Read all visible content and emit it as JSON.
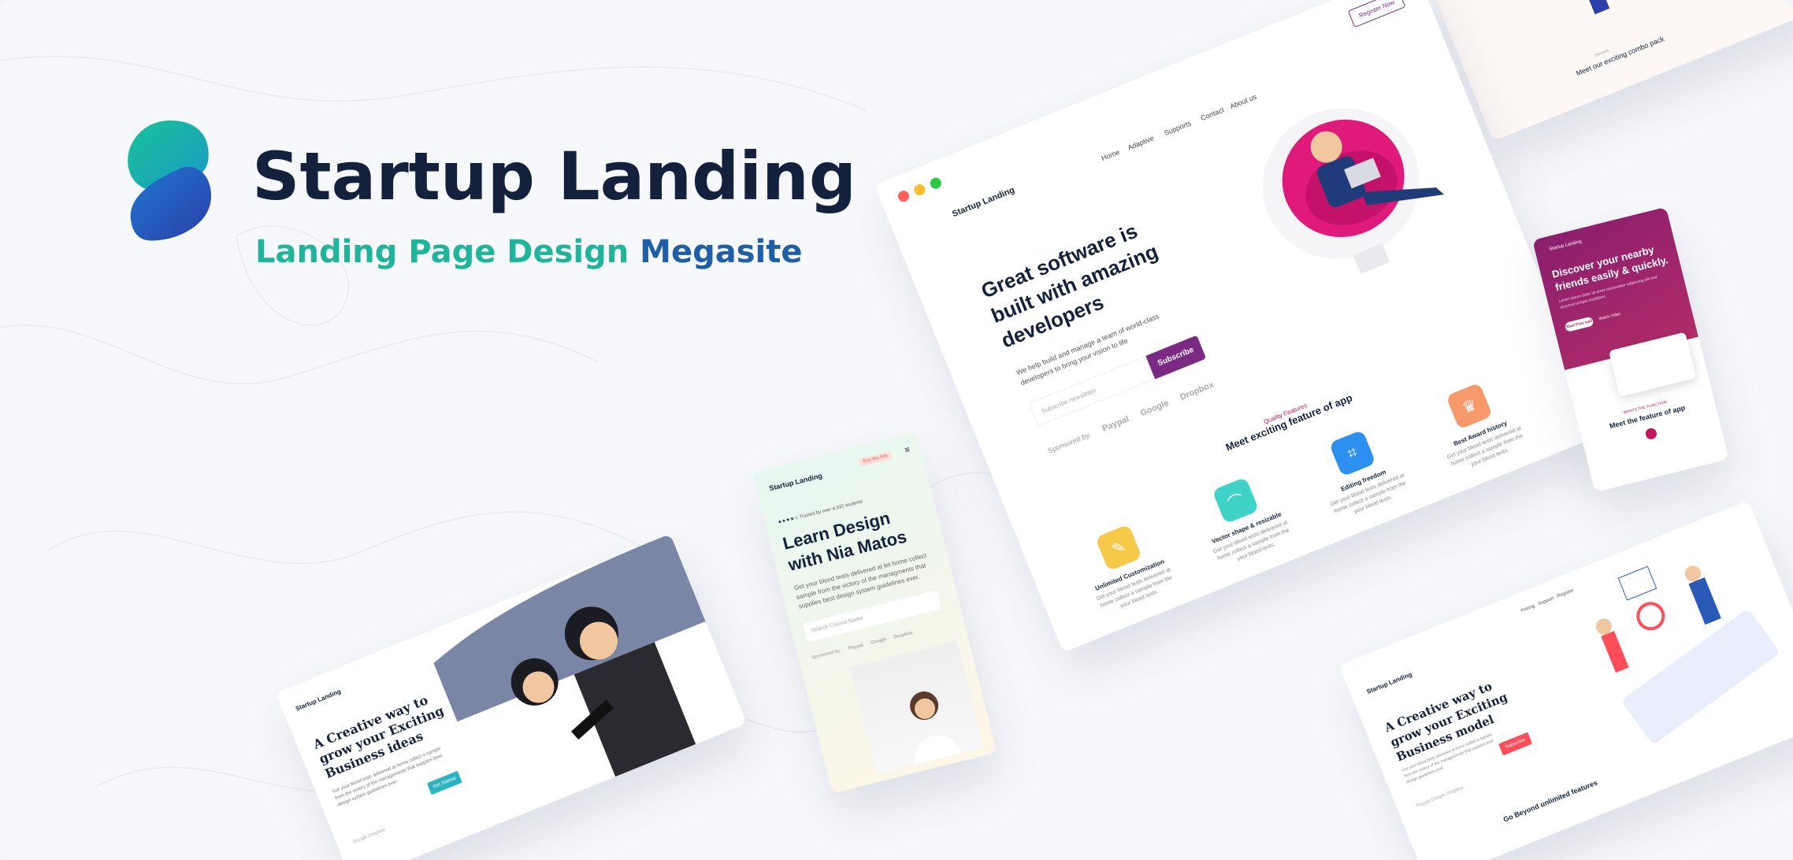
{
  "brand": {
    "title": "Startup Landing",
    "tagline_part1": "Landing Page Design",
    "tagline_part2": "Megasite",
    "colors": {
      "title": "#14213d",
      "tag_green": "#1fb59a",
      "tag_blue": "#1f5fa8",
      "logo_green": "#18c39a",
      "logo_blue": "#2652b8"
    }
  },
  "main_preview": {
    "logo": "Startup Landing",
    "nav": [
      "Home",
      "Adaptive",
      "Supports",
      "Contact",
      "About us"
    ],
    "register_button": "Register Now",
    "headline": "Great software is built with amazing developers",
    "subtext": "We help build and manage a team of world-class developers to bring your vision to life",
    "subscribe_placeholder": "Subscribe newsletter",
    "subscribe_button": "Subscribe",
    "sponsored_label": "Sponsored by:",
    "sponsors": [
      "Paypal",
      "Google",
      "Dropbox"
    ],
    "features_eyebrow": "Quality Features",
    "features_title": "Meet exciting feature of app",
    "features": [
      {
        "name": "Unlimited Customization",
        "desc": "Get your blood tests delivered at home collect a sample from the your blood tests.",
        "color": "#f7c948",
        "icon": "pencil-icon"
      },
      {
        "name": "Vector shape & resizable",
        "desc": "Get your blood tests delivered at home collect a sample from the your blood tests.",
        "color": "#3fd3c8",
        "icon": "vector-icon"
      },
      {
        "name": "Editing freedom",
        "desc": "Get your blood tests delivered at home collect a sample from the your blood tests.",
        "color": "#2d8ff0",
        "icon": "crop-icon"
      },
      {
        "name": "Best Award history",
        "desc": "Get your blood tests delivered at home collect a sample from the your blood tests.",
        "color": "#f79a6b",
        "icon": "trophy-icon"
      }
    ]
  },
  "phone_preview": {
    "logo": "Startup Landing",
    "badge": "Buy the Kits",
    "trusted": "Trusted by over 4,332 students",
    "headline": "Learn Design with Nia Matos",
    "subtext": "Get your blood tests delivered at let home collect sample from the victory of the managments that supplies best design system guidelines ever.",
    "search_placeholder": "Search Course Name",
    "sponsored_label": "Sponsored by:",
    "sponsors": [
      "Paypal",
      "Google",
      "Dropbox"
    ]
  },
  "bottom_left_preview": {
    "logo": "Startup Landing",
    "headline": "A Creative way to grow your Exciting Business ideas",
    "subtext": "Get your blood tests delivered at home collect a sample from the victory of the managements that supplies best design system guidelines ever.",
    "button": "Get Started",
    "sponsors": [
      "Google",
      "Dropbox"
    ]
  },
  "bottom_right_preview": {
    "logo": "Startup Landing",
    "nav": [
      "Pricing",
      "Support",
      "Register"
    ],
    "headline": "A Creative way to grow your Exciting Business model",
    "subtext": "Get your blood tests delivered at home collect a sample from the victory of the managements that supplies best design guidelines ever.",
    "button": "Subscribe",
    "sponsors": [
      "Paypal",
      "Google",
      "Dropbox"
    ],
    "footer_title": "Go Beyond unlimited features"
  },
  "right_phone_preview": {
    "logo": "Startup Landing",
    "headline": "Discover your nearby friends easily & quickly.",
    "subtext": "Lorem ipsum dolor sit amet consectetur adipiscing elit sed eiusmod tempor incididunt.",
    "button": "Start Free trail",
    "watch": "Watch Video",
    "eyebrow": "WHATS THE FUNCTION",
    "title": "Meet the feature of app"
  },
  "top_right_preview": {
    "eyebrow": "Services",
    "title": "Meet our exciting combo pack"
  }
}
